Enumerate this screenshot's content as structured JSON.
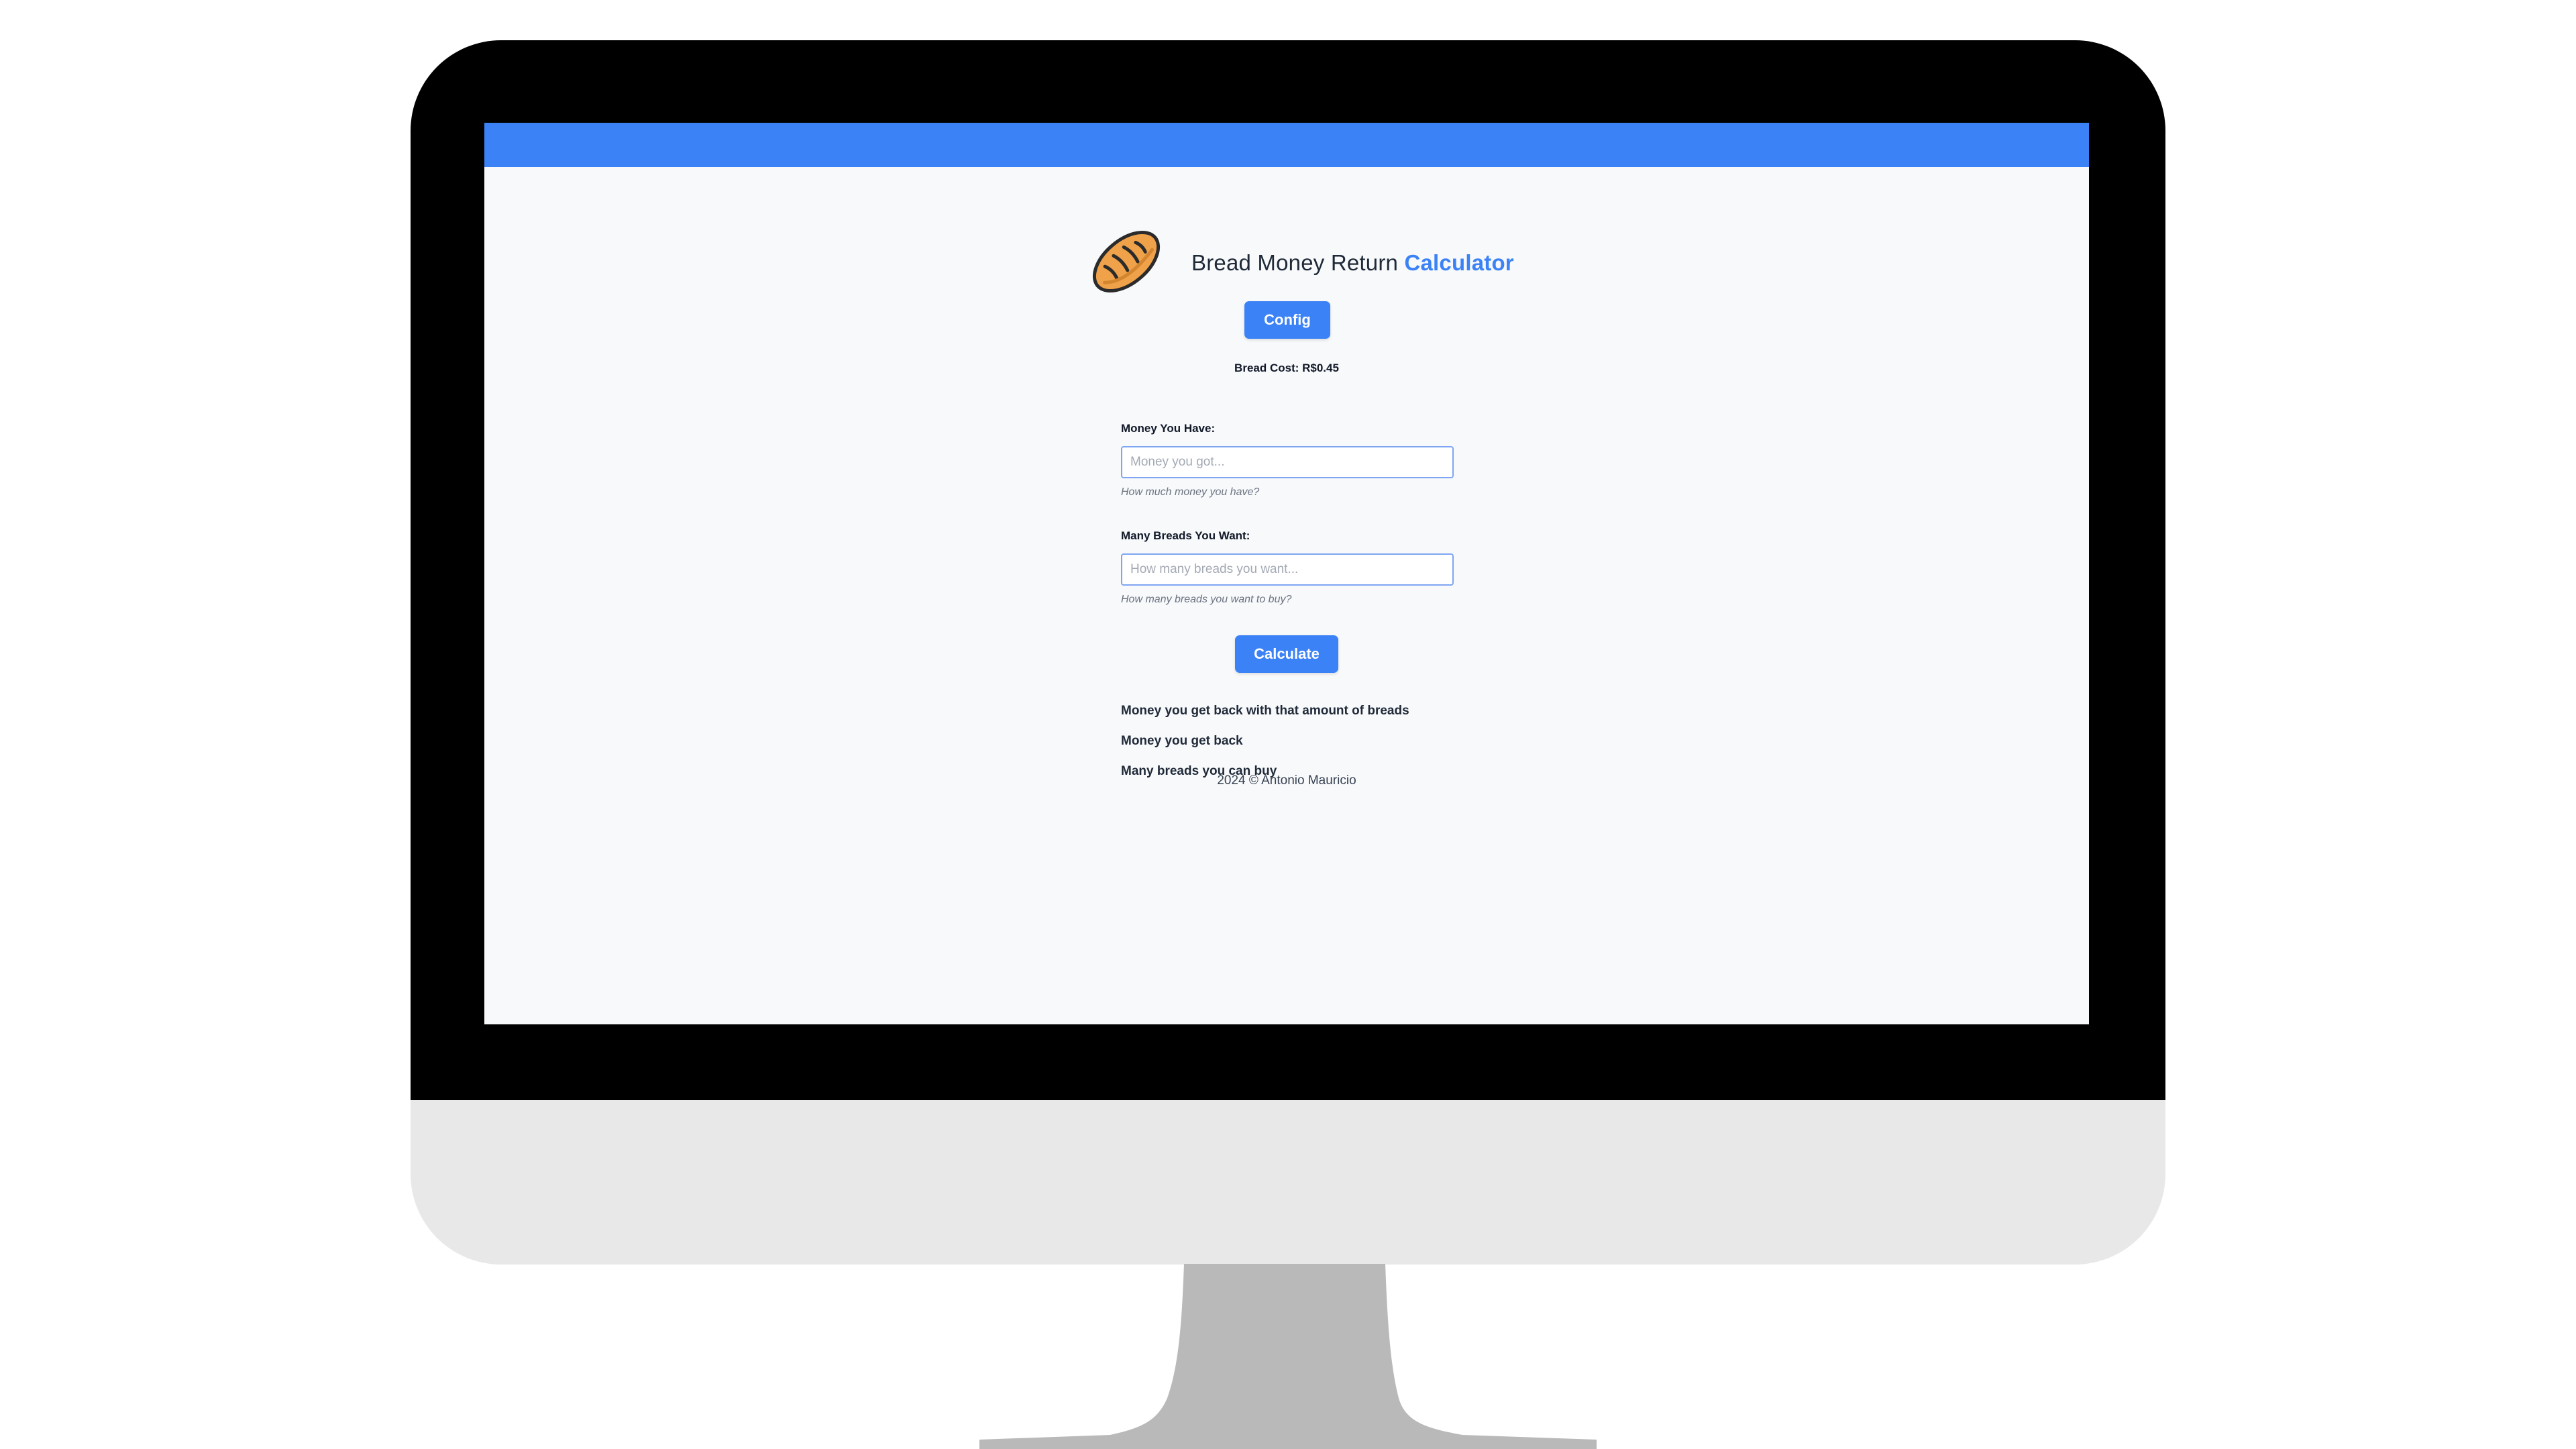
{
  "app": {
    "title_prefix": "Bread Money Return ",
    "title_accent": "Calculator",
    "bread_icon": "bread-loaf-icon"
  },
  "config": {
    "button_label": "Config",
    "bread_cost_text": "Bread Cost: R$0.45"
  },
  "form": {
    "money": {
      "label": "Money You Have:",
      "placeholder": "Money you got...",
      "value": "",
      "help": "How much money you have?"
    },
    "breads": {
      "label": "Many Breads You Want:",
      "placeholder": "How many breads you want...",
      "value": "",
      "help": "How many breads you want to buy?"
    },
    "calculate_label": "Calculate"
  },
  "results": {
    "line1": "Money you get back with that amount of breads",
    "line2": "Money you get back",
    "line3": "Many breads you can buy"
  },
  "footer": {
    "text": "2024 © Antonio Mauricio"
  },
  "colors": {
    "accent": "#3b82f6",
    "topbar": "#3b82f6",
    "screen_background": "#f7f9fb",
    "bezel": "#000000",
    "chin": "#e8e8e8",
    "stand": "#b9b9b9"
  }
}
